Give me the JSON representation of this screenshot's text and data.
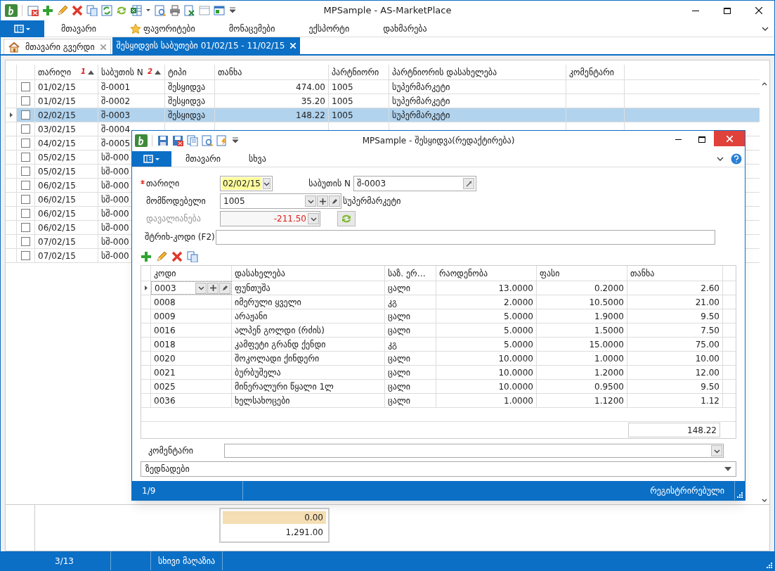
{
  "window": {
    "title": "MPSample - AS-MarketPlace"
  },
  "menu": [
    {
      "label": "მთავარი",
      "kind": "plain"
    },
    {
      "label": "ფავორიტები",
      "kind": "starred"
    },
    {
      "label": "მონაცემები",
      "kind": "plain"
    },
    {
      "label": "ექსპორტი",
      "kind": "plain"
    },
    {
      "label": "დახმარება",
      "kind": "plain"
    }
  ],
  "tabs": [
    {
      "label": "მთავარი გვერდი",
      "selected": false,
      "kind": "home"
    },
    {
      "label": "შესყიდვის საბუთები 01/02/15 - 11/02/15",
      "selected": true,
      "kind": "plain"
    }
  ],
  "documents": {
    "columns": [
      {
        "label": "თარიღი",
        "sort_index": "1",
        "sorted": true
      },
      {
        "label": "საბუთის N",
        "sort_index": "2",
        "sorted": true
      },
      {
        "label": "ტიპი",
        "sorted": false
      },
      {
        "label": "თანხა",
        "sorted": false
      },
      {
        "label": "პარტნიორი",
        "sorted": false
      },
      {
        "label": "პარტნიორის დასახელება",
        "sorted": false
      },
      {
        "label": "კომენტარი",
        "sorted": false
      }
    ],
    "rows": [
      {
        "checked": false,
        "selected": false,
        "cells": [
          "01/02/15",
          "შ-0001",
          "შესყიდვა",
          "474.00",
          "1005",
          "სუპერმარკეტი"
        ]
      },
      {
        "checked": false,
        "selected": false,
        "cells": [
          "01/02/15",
          "შ-0002",
          "შესყიდვა",
          "35.20",
          "1005",
          "სუპერმარკეტი"
        ]
      },
      {
        "checked": false,
        "selected": true,
        "cells": [
          "02/02/15",
          "შ-0003",
          "შესყიდვა",
          "148.22",
          "1005",
          "სუპერმარკეტი"
        ]
      },
      {
        "checked": false,
        "selected": false,
        "cells": [
          "03/02/15",
          "შ-0004"
        ]
      },
      {
        "checked": false,
        "selected": false,
        "cells": [
          "04/02/15",
          "შ-0005"
        ]
      },
      {
        "checked": false,
        "selected": false,
        "cells": [
          "05/02/15",
          "სშ-000"
        ]
      },
      {
        "checked": false,
        "selected": false,
        "cells": [
          "05/02/15",
          "სშ-000"
        ]
      },
      {
        "checked": false,
        "selected": false,
        "cells": [
          "06/02/15",
          "სშ-000"
        ]
      },
      {
        "checked": false,
        "selected": false,
        "cells": [
          "06/02/15",
          "სშ-000"
        ]
      },
      {
        "checked": false,
        "selected": false,
        "cells": [
          "06/02/15",
          "სშ-000"
        ]
      },
      {
        "checked": false,
        "selected": false,
        "cells": [
          "06/02/15",
          "სშ-000"
        ]
      },
      {
        "checked": false,
        "selected": false,
        "cells": [
          "07/02/15",
          "სშ-000"
        ]
      },
      {
        "checked": false,
        "selected": false,
        "cells": [
          "07/02/15",
          "სშ-000"
        ]
      }
    ],
    "summary": [
      "0.00",
      "1,291.00"
    ]
  },
  "status_bar": {
    "position": "3/13",
    "store": "სხივი მაღაზია"
  },
  "dialog": {
    "title": "MPSample - შესყიდვა(რედაქტირება)",
    "tabs": [
      "მთავარი",
      "სხვა"
    ],
    "date": {
      "label": "თარიღი",
      "required": true,
      "value": "02/02/15"
    },
    "doc_number": {
      "label": "საბუთის N",
      "value": "შ-0003"
    },
    "supplier": {
      "label": "მომწოდებელი",
      "value": "1005",
      "name": "სუპერმარკეტი"
    },
    "balance": {
      "label": "დავალიანება",
      "value": "-211.50",
      "disabled": true
    },
    "barcode": {
      "label": "შტრიხ-კოდი (F2)"
    },
    "items": {
      "columns": [
        "კოდი",
        "დასახელება",
        "საზ. ერ…",
        "რაოდენობა",
        "ფასი",
        "თანხა"
      ],
      "rows": [
        {
          "current": true,
          "cells": [
            "0003",
            "ფუნთუშა",
            "ცალი",
            "13.0000",
            "0.2000",
            "2.60"
          ]
        },
        {
          "current": false,
          "cells": [
            "0008",
            "იმერული ყველი",
            "კგ",
            "2.0000",
            "10.5000",
            "21.00"
          ]
        },
        {
          "current": false,
          "cells": [
            "0009",
            "არაჟანი",
            "ცალი",
            "5.0000",
            "1.9000",
            "9.50"
          ]
        },
        {
          "current": false,
          "cells": [
            "0016",
            "ალპენ გოლდი (რძის)",
            "ცალი",
            "5.0000",
            "1.5000",
            "7.50"
          ]
        },
        {
          "current": false,
          "cells": [
            "0018",
            "კამფეტი გრანდ ქენდი",
            "კგ",
            "5.0000",
            "15.0000",
            "75.00"
          ]
        },
        {
          "current": false,
          "cells": [
            "0020",
            "შოკოლადი ქინდერი",
            "ცალი",
            "10.0000",
            "1.0000",
            "10.00"
          ]
        },
        {
          "current": false,
          "cells": [
            "0021",
            "ბურბუშელა",
            "ცალი",
            "10.0000",
            "1.2000",
            "12.00"
          ]
        },
        {
          "current": false,
          "cells": [
            "0025",
            "მინერალური წყალი 1ლ",
            "ცალი",
            "10.0000",
            "0.9500",
            "9.50"
          ]
        },
        {
          "current": false,
          "cells": [
            "0036",
            "ხელსახოცები",
            "ცალი",
            "1.0000",
            "1.1200",
            "1.12"
          ]
        }
      ],
      "total": "148.22"
    },
    "comment": {
      "label": "კომენტარი"
    },
    "group": {
      "label": "ზედნადები"
    },
    "status_bar": {
      "position": "1/9",
      "state": "რეგისტრირებული"
    }
  }
}
